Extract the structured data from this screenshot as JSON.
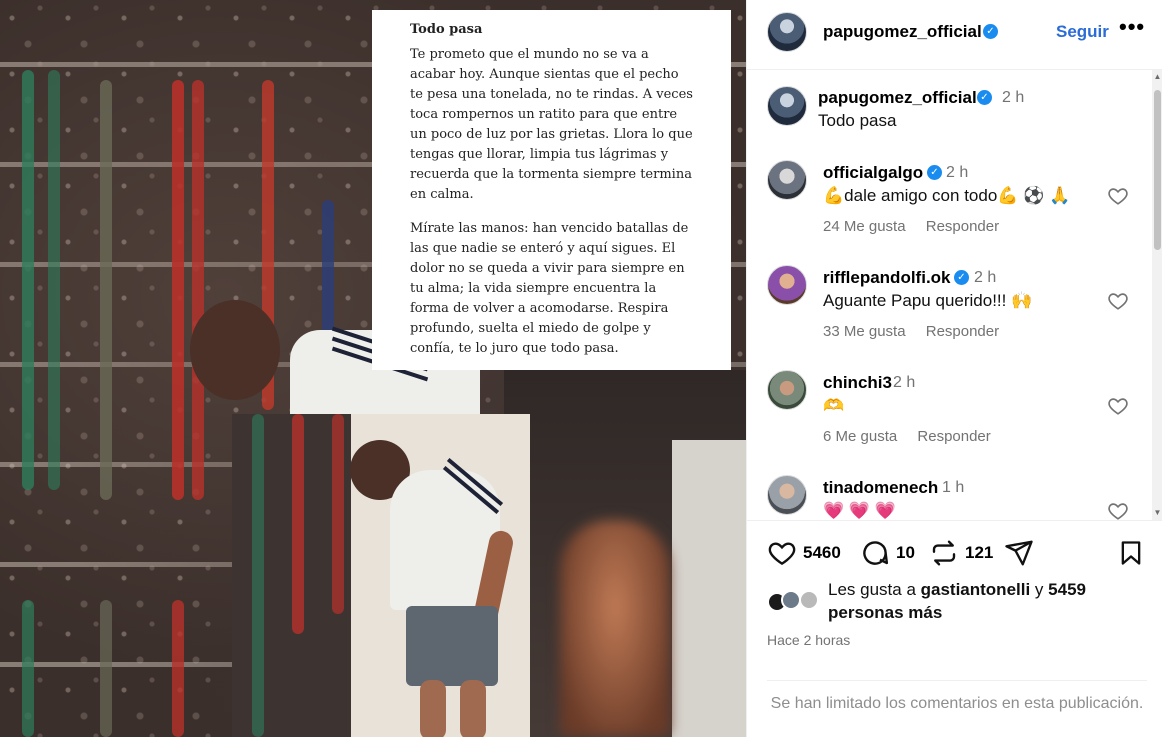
{
  "quote": {
    "title": "Todo pasa",
    "paragraph1": "Te prometo que el mundo no se va a acabar hoy. Aunque sientas que el pecho te pesa una tonelada, no te rindas. A veces toca rompernos un ratito para que entre un poco de luz por las grietas. Llora lo que tengas que llorar, limpia tus lágrimas y recuerda que la tormenta siempre termina en calma.",
    "paragraph2": "Mírate las manos: han vencido batallas de las que nadie se enteró y aquí sigues. El dolor no se queda a vivir para siempre en tu alma; la vida siempre encuentra la forma de volver a acomodarse. Respira profundo, suelta el miedo de golpe y confía, te lo juro que todo pasa."
  },
  "header": {
    "username": "papugomez_official",
    "follow_label": "Seguir",
    "more_label": "•••"
  },
  "caption": {
    "username": "papugomez_official",
    "time": "2 h",
    "text": "Todo pasa"
  },
  "comments": [
    {
      "username": "officialgalgo",
      "verified": true,
      "time": "2 h",
      "text": "💪dale amigo con todo💪 ⚽ 🙏",
      "likes": "24 Me gusta",
      "reply": "Responder"
    },
    {
      "username": "rifflepandolfi.ok",
      "verified": true,
      "time": "2 h",
      "text": "Aguante Papu querido!!! 🙌",
      "likes": "33 Me gusta",
      "reply": "Responder"
    },
    {
      "username": "chinchi3",
      "verified": false,
      "time": "2 h",
      "text": "🫶",
      "likes": "6 Me gusta",
      "reply": "Responder"
    },
    {
      "username": "tinadomenech",
      "verified": false,
      "time": "1 h",
      "text": "💗 💗 💗",
      "likes": "",
      "reply": ""
    }
  ],
  "actions": {
    "likes_count": "5460",
    "comments_count": "10",
    "reposts_count": "121"
  },
  "likes_summary": {
    "prefix": "Les gusta a ",
    "user": "gastiantonelli",
    "middle": " y ",
    "others": "5459 personas más"
  },
  "posted_ago": "Hace 2 horas",
  "comments_limited": "Se han limitado los comentarios en esta publicación.",
  "colors": {
    "accent": "#2b6cd6",
    "verified": "#1a8cf0",
    "muted": "#737373"
  }
}
